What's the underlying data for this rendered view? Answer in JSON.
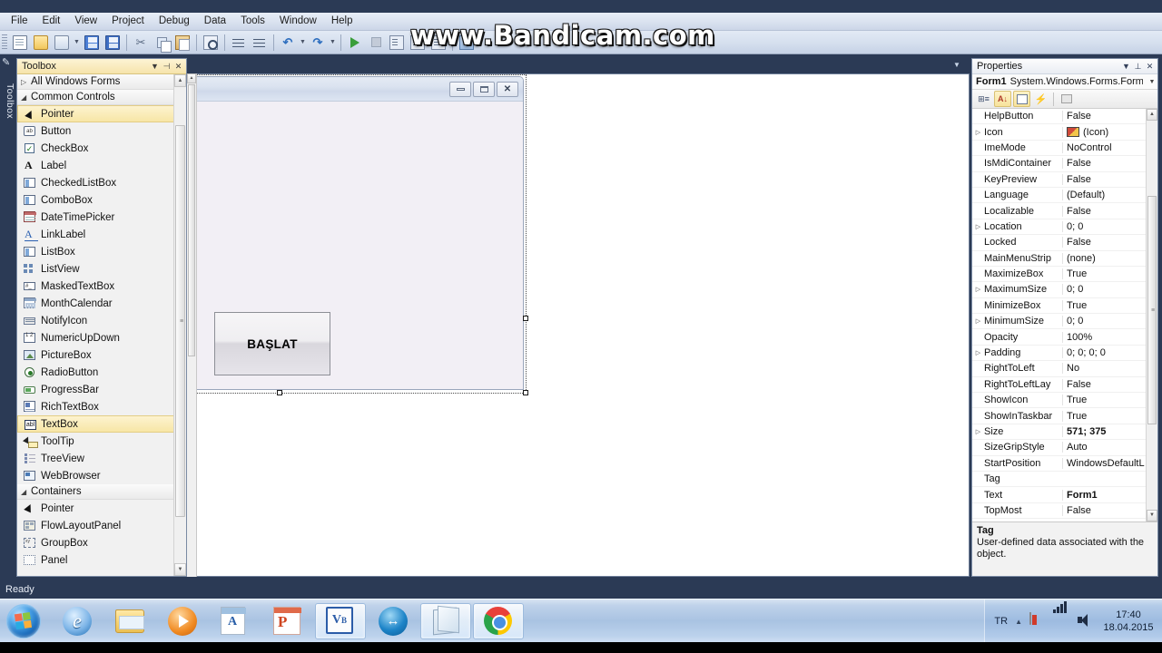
{
  "window": {
    "menu": [
      "File",
      "Edit",
      "View",
      "Project",
      "Debug",
      "Data",
      "Tools",
      "Window",
      "Help"
    ],
    "watermark": "www.Bandicam.com",
    "status": "Ready"
  },
  "toolbar": {
    "buttons": [
      {
        "name": "new-project",
        "icon": "new-project-icon"
      },
      {
        "name": "open-file",
        "icon": "open-folder-icon"
      },
      {
        "name": "add-item",
        "icon": "add-item-icon"
      },
      {
        "name": "add-item-dropdown",
        "icon": "chevron-down-icon"
      },
      {
        "name": "save",
        "icon": "save-icon"
      },
      {
        "name": "save-all",
        "icon": "save-all-icon"
      },
      {
        "name": "cut",
        "icon": "cut-icon"
      },
      {
        "name": "copy",
        "icon": "copy-icon"
      },
      {
        "name": "paste",
        "icon": "paste-icon"
      },
      {
        "name": "find",
        "icon": "find-icon"
      },
      {
        "name": "comment",
        "icon": "comment-lines-icon"
      },
      {
        "name": "uncomment",
        "icon": "uncomment-lines-icon"
      },
      {
        "name": "undo",
        "icon": "undo-icon"
      },
      {
        "name": "undo-dropdown",
        "icon": "chevron-down-icon"
      },
      {
        "name": "redo",
        "icon": "redo-icon"
      },
      {
        "name": "redo-dropdown",
        "icon": "chevron-down-icon"
      },
      {
        "name": "start-debugging",
        "icon": "play-icon"
      },
      {
        "name": "stop-debugging",
        "icon": "stop-icon"
      },
      {
        "name": "step-into",
        "icon": "step-into-icon"
      },
      {
        "name": "step-over",
        "icon": "step-over-icon"
      },
      {
        "name": "step-out",
        "icon": "step-out-icon"
      },
      {
        "name": "solution-explorer",
        "icon": "window-icon"
      }
    ]
  },
  "toolbox": {
    "title": "Toolbox",
    "vertical_tab_label": "Toolbox",
    "header_buttons": [
      "chevron-down-icon",
      "pin-icon",
      "close-icon"
    ],
    "groups": [
      {
        "label": "All Windows Forms",
        "expanded": false,
        "items": []
      },
      {
        "label": "Common Controls",
        "expanded": true,
        "items": [
          {
            "label": "Pointer",
            "icon": "pointer-icon",
            "selected": true
          },
          {
            "label": "Button",
            "icon": "button-icon",
            "selected": false
          },
          {
            "label": "CheckBox",
            "icon": "checkbox-icon",
            "selected": false
          },
          {
            "label": "Label",
            "icon": "label-icon",
            "selected": false
          },
          {
            "label": "CheckedListBox",
            "icon": "checkedlistbox-icon",
            "selected": false
          },
          {
            "label": "ComboBox",
            "icon": "combobox-icon",
            "selected": false
          },
          {
            "label": "DateTimePicker",
            "icon": "datetimepicker-icon",
            "selected": false
          },
          {
            "label": "LinkLabel",
            "icon": "linklabel-icon",
            "selected": false
          },
          {
            "label": "ListBox",
            "icon": "listbox-icon",
            "selected": false
          },
          {
            "label": "ListView",
            "icon": "listview-icon",
            "selected": false
          },
          {
            "label": "MaskedTextBox",
            "icon": "maskedtextbox-icon",
            "selected": false
          },
          {
            "label": "MonthCalendar",
            "icon": "monthcalendar-icon",
            "selected": false
          },
          {
            "label": "NotifyIcon",
            "icon": "notifyicon-icon",
            "selected": false
          },
          {
            "label": "NumericUpDown",
            "icon": "numericupdown-icon",
            "selected": false
          },
          {
            "label": "PictureBox",
            "icon": "picturebox-icon",
            "selected": false
          },
          {
            "label": "RadioButton",
            "icon": "radiobutton-icon",
            "selected": false
          },
          {
            "label": "ProgressBar",
            "icon": "progressbar-icon",
            "selected": false
          },
          {
            "label": "RichTextBox",
            "icon": "richtextbox-icon",
            "selected": false
          },
          {
            "label": "TextBox",
            "icon": "textbox-icon",
            "selected": true
          },
          {
            "label": "ToolTip",
            "icon": "tooltip-icon",
            "selected": false
          },
          {
            "label": "TreeView",
            "icon": "treeview-icon",
            "selected": false
          },
          {
            "label": "WebBrowser",
            "icon": "webbrowser-icon",
            "selected": false
          }
        ]
      },
      {
        "label": "Containers",
        "expanded": true,
        "items": [
          {
            "label": "Pointer",
            "icon": "pointer-icon",
            "selected": false
          },
          {
            "label": "FlowLayoutPanel",
            "icon": "flowlayoutpanel-icon",
            "selected": false
          },
          {
            "label": "GroupBox",
            "icon": "groupbox-icon",
            "selected": false
          },
          {
            "label": "Panel",
            "icon": "panel-icon",
            "selected": false
          }
        ]
      }
    ]
  },
  "designer": {
    "form": {
      "title": "",
      "minimize_label": "minimize-icon",
      "maximize_label": "maximize-icon",
      "close_label": "close-icon",
      "controls": [
        {
          "type": "Button",
          "text": "BAŞLAT"
        }
      ]
    }
  },
  "properties": {
    "title": "Properties",
    "header_buttons": [
      "chevron-down-icon",
      "pin-icon",
      "close-icon"
    ],
    "object_name": "Form1",
    "object_type": "System.Windows.Forms.Form",
    "tools": [
      {
        "name": "categorized-button",
        "icon": "categorized-icon",
        "active": false
      },
      {
        "name": "alphabetical-button",
        "icon": "sort-az-icon",
        "active": true
      },
      {
        "name": "properties-button",
        "icon": "properties-window-icon",
        "active": true
      },
      {
        "name": "events-button",
        "icon": "events-bolt-icon",
        "active": false
      },
      {
        "name": "property-pages-button",
        "icon": "property-pages-icon",
        "active": false
      }
    ],
    "rows": [
      {
        "key": "HelpButton",
        "value": "False",
        "expandable": false,
        "bold": false
      },
      {
        "key": "Icon",
        "value": "(Icon)",
        "expandable": true,
        "bold": false,
        "swatch": true
      },
      {
        "key": "ImeMode",
        "value": "NoControl",
        "expandable": false,
        "bold": false
      },
      {
        "key": "IsMdiContainer",
        "value": "False",
        "expandable": false,
        "bold": false
      },
      {
        "key": "KeyPreview",
        "value": "False",
        "expandable": false,
        "bold": false
      },
      {
        "key": "Language",
        "value": "(Default)",
        "expandable": false,
        "bold": false
      },
      {
        "key": "Localizable",
        "value": "False",
        "expandable": false,
        "bold": false
      },
      {
        "key": "Location",
        "value": "0; 0",
        "expandable": true,
        "bold": false
      },
      {
        "key": "Locked",
        "value": "False",
        "expandable": false,
        "bold": false
      },
      {
        "key": "MainMenuStrip",
        "value": "(none)",
        "expandable": false,
        "bold": false
      },
      {
        "key": "MaximizeBox",
        "value": "True",
        "expandable": false,
        "bold": false
      },
      {
        "key": "MaximumSize",
        "value": "0; 0",
        "expandable": true,
        "bold": false
      },
      {
        "key": "MinimizeBox",
        "value": "True",
        "expandable": false,
        "bold": false
      },
      {
        "key": "MinimumSize",
        "value": "0; 0",
        "expandable": true,
        "bold": false
      },
      {
        "key": "Opacity",
        "value": "100%",
        "expandable": false,
        "bold": false
      },
      {
        "key": "Padding",
        "value": "0; 0; 0; 0",
        "expandable": true,
        "bold": false
      },
      {
        "key": "RightToLeft",
        "value": "No",
        "expandable": false,
        "bold": false
      },
      {
        "key": "RightToLeftLay",
        "value": "False",
        "expandable": false,
        "bold": false
      },
      {
        "key": "ShowIcon",
        "value": "True",
        "expandable": false,
        "bold": false
      },
      {
        "key": "ShowInTaskbar",
        "value": "True",
        "expandable": false,
        "bold": false
      },
      {
        "key": "Size",
        "value": "571; 375",
        "expandable": true,
        "bold": true
      },
      {
        "key": "SizeGripStyle",
        "value": "Auto",
        "expandable": false,
        "bold": false
      },
      {
        "key": "StartPosition",
        "value": "WindowsDefaultL",
        "expandable": false,
        "bold": false
      },
      {
        "key": "Tag",
        "value": "",
        "expandable": false,
        "bold": false
      },
      {
        "key": "Text",
        "value": "Form1",
        "expandable": false,
        "bold": true
      },
      {
        "key": "TopMost",
        "value": "False",
        "expandable": false,
        "bold": false
      }
    ],
    "description": {
      "title": "Tag",
      "text": "User-defined data associated with the object."
    }
  },
  "taskbar": {
    "start_label": "start-orb",
    "items": [
      {
        "name": "internet-explorer",
        "icon": "ie-icon",
        "active": false
      },
      {
        "name": "windows-explorer",
        "icon": "folder-icon",
        "active": false
      },
      {
        "name": "media-player",
        "icon": "media-player-icon",
        "active": false
      },
      {
        "name": "word",
        "icon": "word-icon",
        "active": false
      },
      {
        "name": "powerpoint",
        "icon": "powerpoint-icon",
        "active": false
      },
      {
        "name": "visual-studio-vb",
        "icon": "visual-basic-icon",
        "active": true
      },
      {
        "name": "teamviewer",
        "icon": "teamviewer-icon",
        "active": false
      },
      {
        "name": "notebook-app",
        "icon": "notebook-icon",
        "active": true
      },
      {
        "name": "google-chrome",
        "icon": "chrome-icon",
        "active": true
      }
    ],
    "tray": {
      "language": "TR",
      "show_hidden": "chevron-up-icon",
      "icons": [
        "security-shield-icon",
        "network-signal-icon",
        "volume-icon"
      ],
      "time": "17:40",
      "date": "18.04.2015"
    }
  }
}
